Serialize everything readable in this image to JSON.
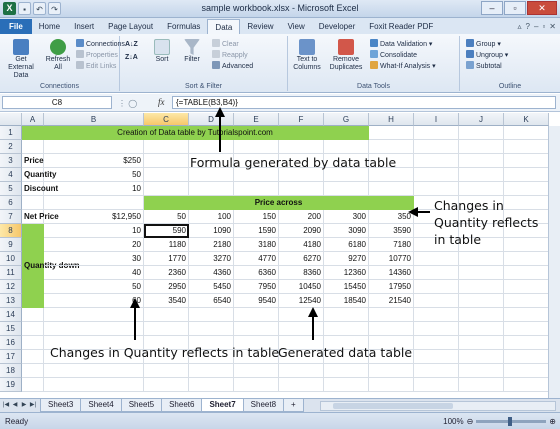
{
  "window": {
    "title": "sample workbook.xlsx - Microsoft Excel"
  },
  "tabs": [
    "File",
    "Home",
    "Insert",
    "Page Layout",
    "Formulas",
    "Data",
    "Review",
    "View",
    "Developer",
    "Foxit Reader PDF"
  ],
  "ribbon": {
    "get_external": "Get External Data",
    "refresh": "Refresh All",
    "connections": "Connections",
    "properties": "Properties",
    "edit_links": "Edit Links",
    "grp_connections": "Connections",
    "sort": "Sort",
    "filter": "Filter",
    "clear": "Clear",
    "reapply": "Reapply",
    "advanced": "Advanced",
    "grp_sort": "Sort & Filter",
    "text_to_columns": "Text to Columns",
    "remove_duplicates": "Remove Duplicates",
    "data_validation": "Data Validation",
    "consolidate": "Consolidate",
    "what_if": "What-If Analysis",
    "grp_tools": "Data Tools",
    "group": "Group",
    "ungroup": "Ungroup",
    "subtotal": "Subtotal",
    "grp_outline": "Outline"
  },
  "formula_bar": {
    "name_box": "C8",
    "fx": "fx",
    "formula": "{=TABLE(B3,B4)}"
  },
  "columns": [
    "A",
    "B",
    "C",
    "D",
    "E",
    "F",
    "G",
    "H",
    "I",
    "J",
    "K"
  ],
  "rows": [
    "1",
    "2",
    "3",
    "4",
    "5",
    "6",
    "7",
    "8",
    "9",
    "10",
    "11",
    "12",
    "13",
    "14",
    "15",
    "16",
    "17",
    "18",
    "19"
  ],
  "sheet": {
    "title": "Creation of Data table by Tutorialspoint.com",
    "price_label": "Price",
    "price_value": "$250",
    "quantity_label": "Quantity",
    "quantity_value": "50",
    "discount_label": "Discount",
    "discount_value": "10",
    "price_across": "Price across",
    "net_price_label": "Net Price",
    "net_price_value": "$12,950",
    "quantity_down": "Quantity down",
    "header_prices": [
      "50",
      "100",
      "150",
      "200",
      "300",
      "350"
    ],
    "quantities": [
      "10",
      "20",
      "30",
      "40",
      "50",
      "60"
    ],
    "table": [
      [
        "590",
        "1090",
        "1590",
        "2090",
        "3090",
        "3590"
      ],
      [
        "1180",
        "2180",
        "3180",
        "4180",
        "6180",
        "7180"
      ],
      [
        "1770",
        "3270",
        "4770",
        "6270",
        "9270",
        "10770"
      ],
      [
        "2360",
        "4360",
        "6360",
        "8360",
        "12360",
        "14360"
      ],
      [
        "2950",
        "5450",
        "7950",
        "10450",
        "15450",
        "17950"
      ],
      [
        "3540",
        "6540",
        "9540",
        "12540",
        "18540",
        "21540"
      ]
    ]
  },
  "annotations": {
    "formula": "Formula generated by data table",
    "changes_right_1": "Changes in",
    "changes_right_2": "Quantity reflects",
    "changes_right_3": "in table",
    "changes_bottom": "Changes in Quantity reflects in table",
    "generated": "Generated data table"
  },
  "sheet_tabs": [
    "Sheet3",
    "Sheet4",
    "Sheet5",
    "Sheet6",
    "Sheet7",
    "Sheet8"
  ],
  "active_sheet": "Sheet7",
  "status": {
    "ready": "Ready",
    "zoom": "100%"
  }
}
